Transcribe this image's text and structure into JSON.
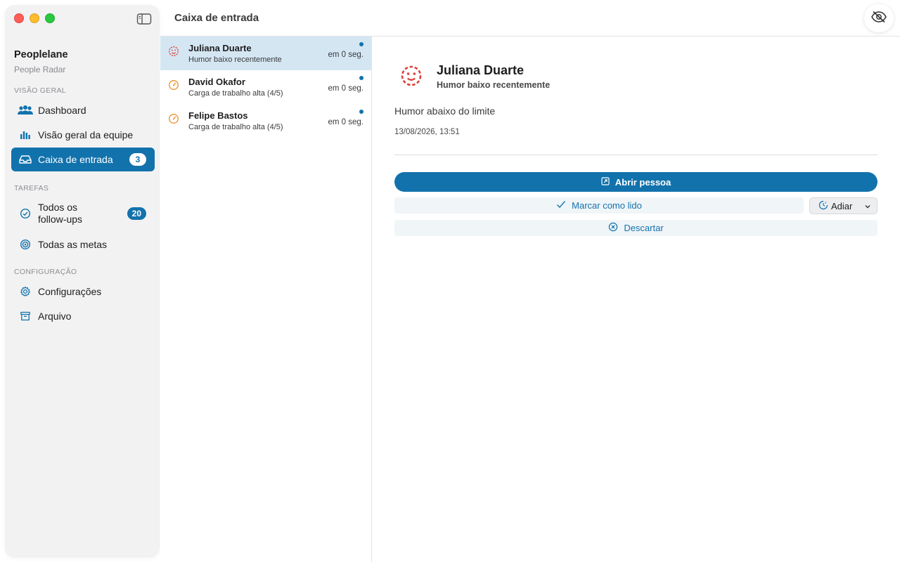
{
  "window": {
    "title": "Caixa de entrada"
  },
  "app": {
    "name": "Peoplelane",
    "subtitle": "People Radar"
  },
  "sidebar": {
    "sections": {
      "overview": "VISÃO GERAL",
      "tasks": "TAREFAS",
      "config": "CONFIGURAÇÃO"
    },
    "items": [
      {
        "label": "Dashboard",
        "icon": "people-icon"
      },
      {
        "label": "Visão geral da equipe",
        "icon": "chart-bars-icon"
      },
      {
        "label": "Caixa de entrada",
        "icon": "inbox-icon",
        "badge": "3",
        "active": true
      },
      {
        "label": "Todos os follow-ups",
        "icon": "check-circle-icon",
        "badge": "20"
      },
      {
        "label": "Todas as metas",
        "icon": "target-icon"
      },
      {
        "label": "Configurações",
        "icon": "gear-icon"
      },
      {
        "label": "Arquivo",
        "icon": "archive-icon"
      }
    ]
  },
  "inbox": {
    "items": [
      {
        "name": "Juliana Duarte",
        "subtitle": "Humor baixo recentemente",
        "time": "em 0 seg.",
        "icon": "mood-face-icon",
        "unread": true,
        "selected": true
      },
      {
        "name": "David Okafor",
        "subtitle": "Carga de trabalho alta (4/5)",
        "time": "em 0 seg.",
        "icon": "gauge-icon",
        "unread": true
      },
      {
        "name": "Felipe Bastos",
        "subtitle": "Carga de trabalho alta (4/5)",
        "time": "em 0 seg.",
        "icon": "gauge-icon",
        "unread": true
      }
    ]
  },
  "detail": {
    "name": "Juliana Duarte",
    "subtitle": "Humor baixo recentemente",
    "message": "Humor abaixo do limite",
    "date": "13/08/2026, 13:51",
    "actions": {
      "open": "Abrir pessoa",
      "mark_read": "Marcar como lido",
      "snooze": "Adiar",
      "dismiss": "Descartar"
    }
  },
  "colors": {
    "accent": "#1272ac",
    "mood_red": "#e0403a",
    "workload_orange": "#f0902a",
    "selected_row": "#d4e6f2"
  }
}
